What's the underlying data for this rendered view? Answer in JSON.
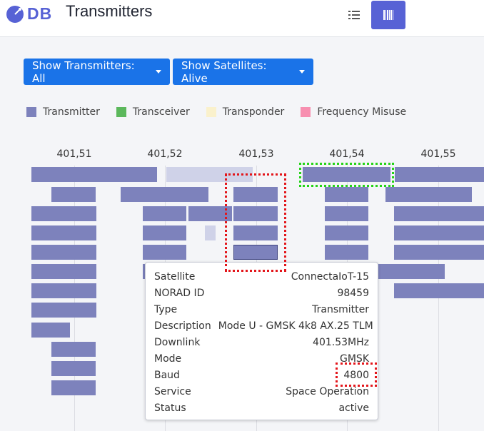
{
  "app": {
    "logo_text": "DB",
    "title": "Transmitters"
  },
  "toolbar": {
    "list_view_icon": "list-icon",
    "bars_view_icon": "barcode-icon",
    "active_view": "bars"
  },
  "filters": {
    "transmitters_label": "Show Transmitters: All",
    "satellites_label": "Show Satellites: Alive"
  },
  "legend": {
    "items": [
      {
        "label": "Transmitter",
        "color": "#7d82bc"
      },
      {
        "label": "Transceiver",
        "color": "#5cb85c"
      },
      {
        "label": "Transponder",
        "color": "#faf1cc"
      },
      {
        "label": "Frequency Misuse",
        "color": "#f78fb0"
      }
    ]
  },
  "axis": {
    "ticks": [
      "401,51",
      "401,52",
      "401,53",
      "401,54",
      "401,55"
    ]
  },
  "tooltip": {
    "rows": [
      {
        "key": "Satellite",
        "value": "ConnectaIoT-15"
      },
      {
        "key": "NORAD ID",
        "value": "98459"
      },
      {
        "key": "Type",
        "value": "Transmitter"
      },
      {
        "key": "Description",
        "value": "Mode U - GMSK 4k8 AX.25 TLM"
      },
      {
        "key": "Downlink",
        "value": "401.53MHz"
      },
      {
        "key": "Mode",
        "value": "GMSK"
      },
      {
        "key": "Baud",
        "value": "4800"
      },
      {
        "key": "Service",
        "value": "Space Operation"
      },
      {
        "key": "Status",
        "value": "active"
      }
    ]
  },
  "colors": {
    "accent": "#5762d5",
    "dropdown": "#1a73e8",
    "bar": "#7d82bc",
    "bar_light": "#cfd2e8"
  }
}
